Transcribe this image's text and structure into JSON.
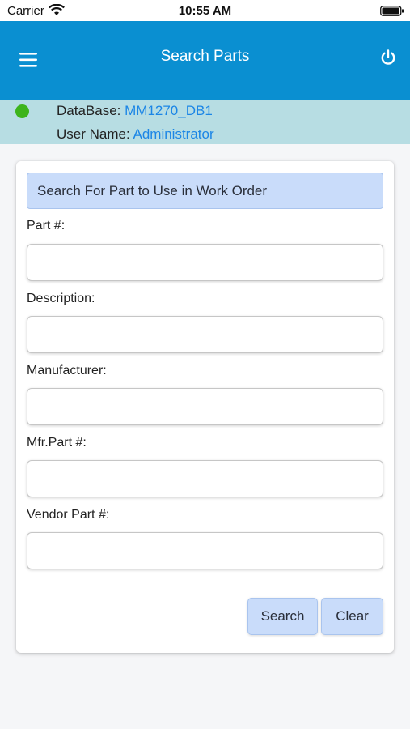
{
  "status_bar": {
    "carrier": "Carrier",
    "time": "10:55 AM",
    "wifi_icon": "wifi-icon",
    "battery_icon": "battery-icon"
  },
  "header": {
    "title": "Search Parts",
    "menu_icon": "hamburger-menu-icon",
    "power_icon": "power-icon",
    "background_color": "#0a8fd1"
  },
  "info": {
    "status_color": "#3db41c",
    "database_label": "DataBase:",
    "database_value": "MM1270_DB1",
    "username_label": "User Name:",
    "username_value": "Administrator"
  },
  "form": {
    "heading": "Search For Part to Use in Work Order",
    "fields": [
      {
        "label": "Part #:",
        "value": ""
      },
      {
        "label": "Description:",
        "value": ""
      },
      {
        "label": "Manufacturer:",
        "value": ""
      },
      {
        "label": "Mfr.Part #:",
        "value": ""
      },
      {
        "label": "Vendor Part #:",
        "value": ""
      }
    ],
    "search_button": "Search",
    "clear_button": "Clear"
  }
}
